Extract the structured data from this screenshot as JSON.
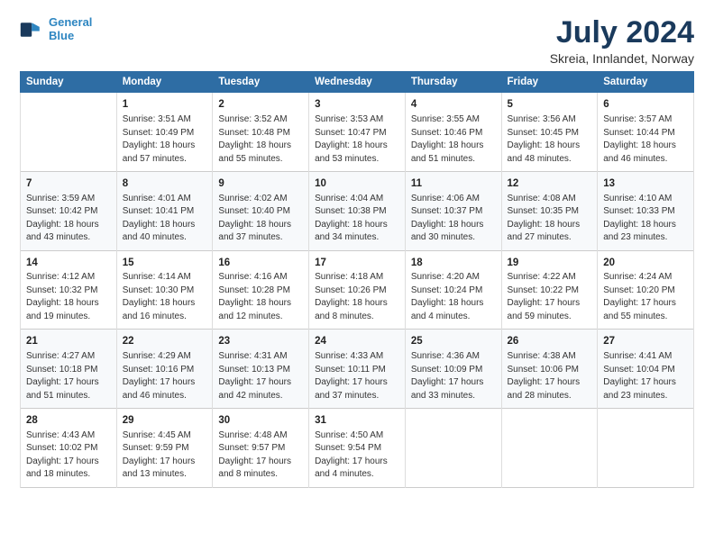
{
  "logo": {
    "line1": "General",
    "line2": "Blue"
  },
  "title": "July 2024",
  "subtitle": "Skreia, Innlandet, Norway",
  "columns": [
    "Sunday",
    "Monday",
    "Tuesday",
    "Wednesday",
    "Thursday",
    "Friday",
    "Saturday"
  ],
  "weeks": [
    [
      {
        "day": "",
        "content": ""
      },
      {
        "day": "1",
        "content": "Sunrise: 3:51 AM\nSunset: 10:49 PM\nDaylight: 18 hours\nand 57 minutes."
      },
      {
        "day": "2",
        "content": "Sunrise: 3:52 AM\nSunset: 10:48 PM\nDaylight: 18 hours\nand 55 minutes."
      },
      {
        "day": "3",
        "content": "Sunrise: 3:53 AM\nSunset: 10:47 PM\nDaylight: 18 hours\nand 53 minutes."
      },
      {
        "day": "4",
        "content": "Sunrise: 3:55 AM\nSunset: 10:46 PM\nDaylight: 18 hours\nand 51 minutes."
      },
      {
        "day": "5",
        "content": "Sunrise: 3:56 AM\nSunset: 10:45 PM\nDaylight: 18 hours\nand 48 minutes."
      },
      {
        "day": "6",
        "content": "Sunrise: 3:57 AM\nSunset: 10:44 PM\nDaylight: 18 hours\nand 46 minutes."
      }
    ],
    [
      {
        "day": "7",
        "content": "Sunrise: 3:59 AM\nSunset: 10:42 PM\nDaylight: 18 hours\nand 43 minutes."
      },
      {
        "day": "8",
        "content": "Sunrise: 4:01 AM\nSunset: 10:41 PM\nDaylight: 18 hours\nand 40 minutes."
      },
      {
        "day": "9",
        "content": "Sunrise: 4:02 AM\nSunset: 10:40 PM\nDaylight: 18 hours\nand 37 minutes."
      },
      {
        "day": "10",
        "content": "Sunrise: 4:04 AM\nSunset: 10:38 PM\nDaylight: 18 hours\nand 34 minutes."
      },
      {
        "day": "11",
        "content": "Sunrise: 4:06 AM\nSunset: 10:37 PM\nDaylight: 18 hours\nand 30 minutes."
      },
      {
        "day": "12",
        "content": "Sunrise: 4:08 AM\nSunset: 10:35 PM\nDaylight: 18 hours\nand 27 minutes."
      },
      {
        "day": "13",
        "content": "Sunrise: 4:10 AM\nSunset: 10:33 PM\nDaylight: 18 hours\nand 23 minutes."
      }
    ],
    [
      {
        "day": "14",
        "content": "Sunrise: 4:12 AM\nSunset: 10:32 PM\nDaylight: 18 hours\nand 19 minutes."
      },
      {
        "day": "15",
        "content": "Sunrise: 4:14 AM\nSunset: 10:30 PM\nDaylight: 18 hours\nand 16 minutes."
      },
      {
        "day": "16",
        "content": "Sunrise: 4:16 AM\nSunset: 10:28 PM\nDaylight: 18 hours\nand 12 minutes."
      },
      {
        "day": "17",
        "content": "Sunrise: 4:18 AM\nSunset: 10:26 PM\nDaylight: 18 hours\nand 8 minutes."
      },
      {
        "day": "18",
        "content": "Sunrise: 4:20 AM\nSunset: 10:24 PM\nDaylight: 18 hours\nand 4 minutes."
      },
      {
        "day": "19",
        "content": "Sunrise: 4:22 AM\nSunset: 10:22 PM\nDaylight: 17 hours\nand 59 minutes."
      },
      {
        "day": "20",
        "content": "Sunrise: 4:24 AM\nSunset: 10:20 PM\nDaylight: 17 hours\nand 55 minutes."
      }
    ],
    [
      {
        "day": "21",
        "content": "Sunrise: 4:27 AM\nSunset: 10:18 PM\nDaylight: 17 hours\nand 51 minutes."
      },
      {
        "day": "22",
        "content": "Sunrise: 4:29 AM\nSunset: 10:16 PM\nDaylight: 17 hours\nand 46 minutes."
      },
      {
        "day": "23",
        "content": "Sunrise: 4:31 AM\nSunset: 10:13 PM\nDaylight: 17 hours\nand 42 minutes."
      },
      {
        "day": "24",
        "content": "Sunrise: 4:33 AM\nSunset: 10:11 PM\nDaylight: 17 hours\nand 37 minutes."
      },
      {
        "day": "25",
        "content": "Sunrise: 4:36 AM\nSunset: 10:09 PM\nDaylight: 17 hours\nand 33 minutes."
      },
      {
        "day": "26",
        "content": "Sunrise: 4:38 AM\nSunset: 10:06 PM\nDaylight: 17 hours\nand 28 minutes."
      },
      {
        "day": "27",
        "content": "Sunrise: 4:41 AM\nSunset: 10:04 PM\nDaylight: 17 hours\nand 23 minutes."
      }
    ],
    [
      {
        "day": "28",
        "content": "Sunrise: 4:43 AM\nSunset: 10:02 PM\nDaylight: 17 hours\nand 18 minutes."
      },
      {
        "day": "29",
        "content": "Sunrise: 4:45 AM\nSunset: 9:59 PM\nDaylight: 17 hours\nand 13 minutes."
      },
      {
        "day": "30",
        "content": "Sunrise: 4:48 AM\nSunset: 9:57 PM\nDaylight: 17 hours\nand 8 minutes."
      },
      {
        "day": "31",
        "content": "Sunrise: 4:50 AM\nSunset: 9:54 PM\nDaylight: 17 hours\nand 4 minutes."
      },
      {
        "day": "",
        "content": ""
      },
      {
        "day": "",
        "content": ""
      },
      {
        "day": "",
        "content": ""
      }
    ]
  ]
}
